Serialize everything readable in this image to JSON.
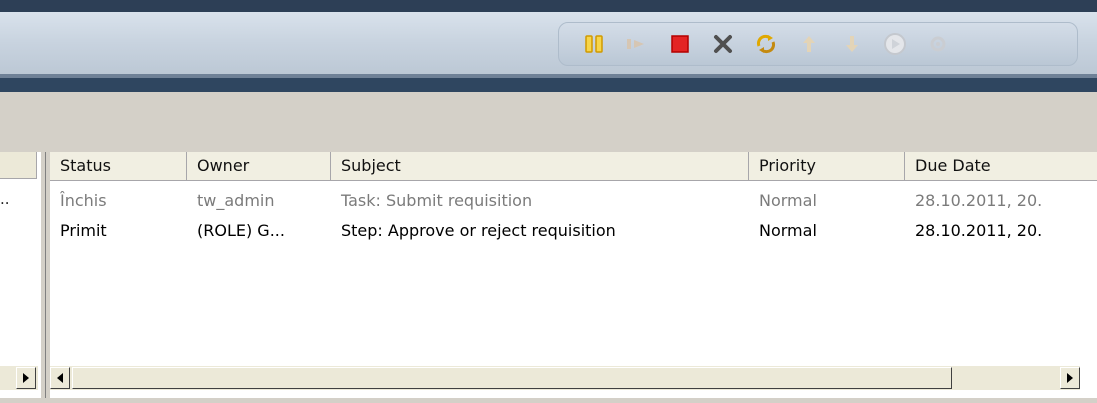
{
  "toolbar": {
    "buttons": [
      {
        "name": "pause-icon",
        "color": "#e8b400"
      },
      {
        "name": "step-icon",
        "color": "#c9b8a8"
      },
      {
        "name": "stop-icon",
        "color": "#e01818"
      },
      {
        "name": "delete-icon",
        "color": "#555555"
      },
      {
        "name": "refresh-icon",
        "color": "#d6a21a"
      },
      {
        "name": "move-up-icon",
        "color": "#d9c9a9"
      },
      {
        "name": "move-down-icon",
        "color": "#d9c9a9"
      },
      {
        "name": "run-icon",
        "color": "#c9c9c9"
      },
      {
        "name": "settings-icon",
        "color": "#c9c9c9"
      }
    ]
  },
  "left_pane": {
    "row_truncation": ".."
  },
  "table": {
    "columns": [
      "Status",
      "Owner",
      "Subject",
      "Priority",
      "Due Date"
    ],
    "rows": [
      {
        "status": "Închis",
        "owner": "tw_admin",
        "subject": "Task: Submit requisition",
        "priority": "Normal",
        "due_date": "28.10.2011, 20.",
        "state": "closed"
      },
      {
        "status": "Primit",
        "owner": "(ROLE) G...",
        "subject": "Step:  Approve or reject requisition",
        "priority": "Normal",
        "due_date": "28.10.2011, 20.",
        "state": "open"
      }
    ]
  }
}
